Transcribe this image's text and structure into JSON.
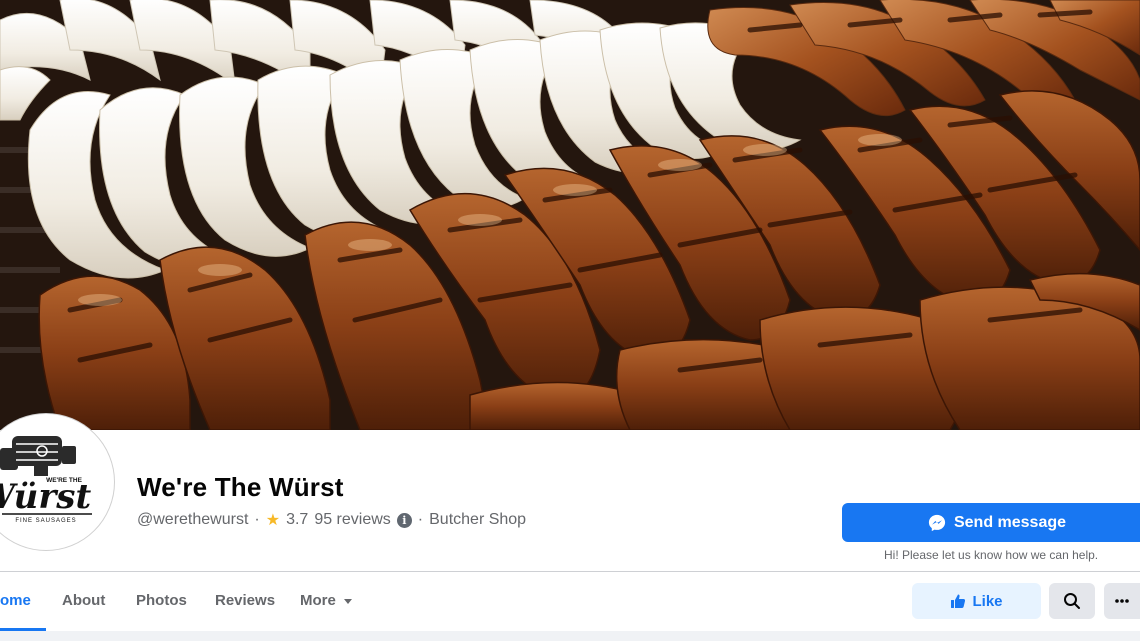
{
  "page": {
    "name": "We're The Würst",
    "handle": "@werethewurst",
    "rating": "3.7",
    "reviews_count": "95 reviews",
    "category": "Butcher Shop",
    "separator": "·"
  },
  "logo": {
    "line1": "WE'RE THE",
    "line2": "Würst",
    "line3": "FINE SAUSAGES"
  },
  "actions": {
    "send_message": "Send message",
    "helper_text": "Hi! Please let us know how we can help.",
    "like": "Like"
  },
  "tabs": [
    {
      "label": "ome",
      "active": true
    },
    {
      "label": "About",
      "active": false
    },
    {
      "label": "Photos",
      "active": false
    },
    {
      "label": "Reviews",
      "active": false
    },
    {
      "label": "More",
      "active": false
    }
  ],
  "icons": {
    "messenger": "messenger-icon",
    "like": "thumbs-up-icon",
    "search": "search-icon",
    "more": "ellipsis-icon",
    "star": "star-icon",
    "info": "info-icon",
    "dropdown": "chevron-down-icon"
  },
  "colors": {
    "accent": "#1877f2",
    "like_bg": "#e7f3ff",
    "star": "#f7b928",
    "secondary_text": "#65676b"
  }
}
